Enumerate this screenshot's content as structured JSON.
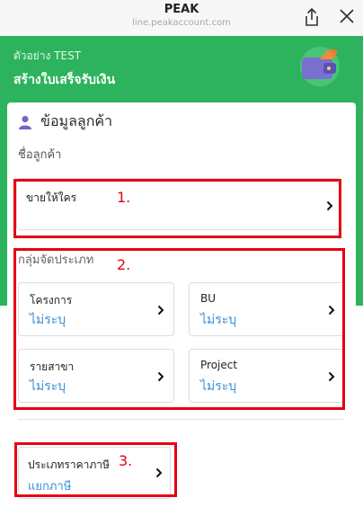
{
  "browser": {
    "title": "PEAK",
    "url": "line.peakaccount.com"
  },
  "header": {
    "subtitle": "ตัวอย่าง TEST",
    "title": "สร้างใบเสร็จรับเงิน"
  },
  "customer_section": {
    "heading": "ข้อมูลลูกค้า",
    "name_label": "ชื่อลูกค้า",
    "sell_to": "ขายให้ใคร"
  },
  "group_section": {
    "label": "กลุ่มจัดประเภท",
    "items": [
      {
        "title": "โครงการ",
        "value": "ไม่ระบุ"
      },
      {
        "title": "BU",
        "value": "ไม่ระบุ"
      },
      {
        "title": "รายสาขา",
        "value": "ไม่ระบุ"
      },
      {
        "title": "Project",
        "value": "ไม่ระบุ"
      }
    ]
  },
  "tax_section": {
    "title": "ประเภทราคาภาษี",
    "value": "แยกภาษี"
  },
  "annotations": [
    "1.",
    "2.",
    "3."
  ],
  "colors": {
    "header_green": "#2db35d",
    "annotation_red": "#e50012",
    "value_blue": "#3b8fd6"
  }
}
